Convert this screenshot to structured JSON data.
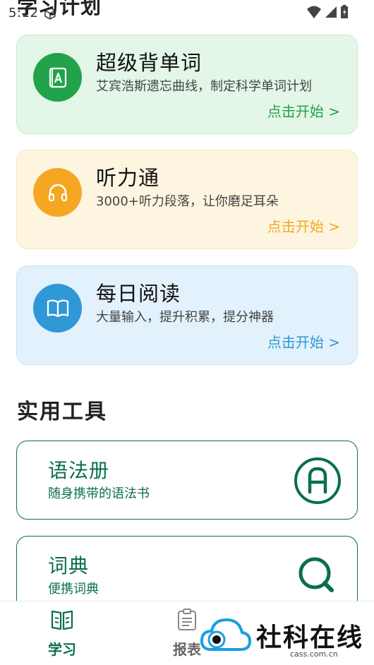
{
  "status_bar": {
    "time": "5:12"
  },
  "section_study_plan": {
    "title": "学习计划"
  },
  "plan_cards": [
    {
      "title": "超级背单词",
      "desc": "艾宾浩斯遗忘曲线，制定科学单词计划",
      "start": "点击开始 >",
      "icon": "vocab-book-icon",
      "color": "#22a24a"
    },
    {
      "title": "听力通",
      "desc": "3000+听力段落，让你磨足耳朵",
      "start": "点击开始 >",
      "icon": "headphones-icon",
      "color": "#f5a623"
    },
    {
      "title": "每日阅读",
      "desc": "大量输入，提升积累，提分神器",
      "start": "点击开始 >",
      "icon": "open-book-icon",
      "color": "#2f98d6"
    }
  ],
  "section_tools": {
    "title": "实用工具"
  },
  "tools": [
    {
      "title": "语法册",
      "desc": "随身携带的语法书",
      "icon": "grammar-a-icon"
    },
    {
      "title": "词典",
      "desc": "便携词典",
      "icon": "search-icon"
    }
  ],
  "tabbar": {
    "study_label": "学习",
    "report_label": "报表",
    "active_color": "#0a6e4f"
  },
  "watermark": {
    "text": "社科在线",
    "sub": "cass.com.cn"
  }
}
